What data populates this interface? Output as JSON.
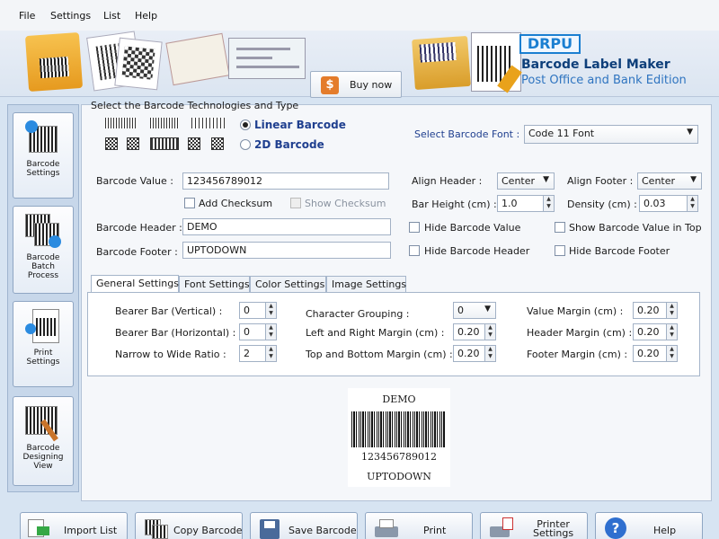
{
  "menu": [
    "File",
    "Settings",
    "List",
    "Help"
  ],
  "banner": {
    "buy_now": "Buy now",
    "buy_icon": "$",
    "brand": "DRPU",
    "title": "Barcode Label Maker",
    "subtitle": "Post Office and Bank Edition"
  },
  "sidebar": [
    {
      "label": "Barcode\nSettings",
      "icon": "barcode-settings-icon"
    },
    {
      "label": "Barcode\nBatch\nProcess",
      "icon": "batch-process-icon"
    },
    {
      "label": "Print\nSettings",
      "icon": "print-settings-icon"
    },
    {
      "label": "Barcode\nDesigning\nView",
      "icon": "designing-view-icon"
    }
  ],
  "tech": {
    "section_title": "Select the Barcode Technologies and Type",
    "linear": "Linear Barcode",
    "two_d": "2D Barcode",
    "selected": "linear",
    "font_label": "Select Barcode Font :",
    "font_value": "Code 11 Font"
  },
  "form": {
    "value_label": "Barcode Value :",
    "value": "123456789012",
    "add_checksum": "Add Checksum",
    "show_checksum": "Show Checksum",
    "header_label": "Barcode Header :",
    "header": "DEMO",
    "footer_label": "Barcode Footer :",
    "footer": "UPTODOWN",
    "align_header_label": "Align Header :",
    "align_header": "Center",
    "align_footer_label": "Align Footer :",
    "align_footer": "Center",
    "bar_height_label": "Bar Height (cm) :",
    "bar_height": "1.0",
    "density_label": "Density (cm) :",
    "density": "0.03",
    "hide_value": "Hide Barcode Value",
    "show_value_top": "Show Barcode Value in Top",
    "hide_header": "Hide Barcode Header",
    "hide_footer": "Hide Barcode Footer"
  },
  "tabs": [
    "General Settings",
    "Font Settings",
    "Color Settings",
    "Image Settings"
  ],
  "general": {
    "bearer_v_label": "Bearer Bar (Vertical) :",
    "bearer_v": "0",
    "bearer_h_label": "Bearer Bar (Horizontal) :",
    "bearer_h": "0",
    "ratio_label": "Narrow to Wide Ratio :",
    "ratio": "2",
    "grouping_label": "Character Grouping :",
    "grouping": "0",
    "lr_margin_label": "Left and Right Margin (cm) :",
    "lr_margin": "0.20",
    "tb_margin_label": "Top and Bottom Margin (cm) :",
    "tb_margin": "0.20",
    "value_margin_label": "Value Margin (cm) :",
    "value_margin": "0.20",
    "header_margin_label": "Header Margin (cm) :",
    "header_margin": "0.20",
    "footer_margin_label": "Footer Margin (cm) :",
    "footer_margin": "0.20"
  },
  "preview": {
    "header": "DEMO",
    "value": "123456789012",
    "footer": "UPTODOWN"
  },
  "bottom": [
    {
      "label": "Import List",
      "icon": "import-list-icon"
    },
    {
      "label": "Copy Barcode",
      "icon": "copy-barcode-icon"
    },
    {
      "label": "Save Barcode",
      "icon": "save-barcode-icon"
    },
    {
      "label": "Print",
      "icon": "print-icon"
    },
    {
      "label": "Printer\nSettings",
      "icon": "printer-settings-icon"
    },
    {
      "label": "Help",
      "icon": "help-icon"
    }
  ]
}
